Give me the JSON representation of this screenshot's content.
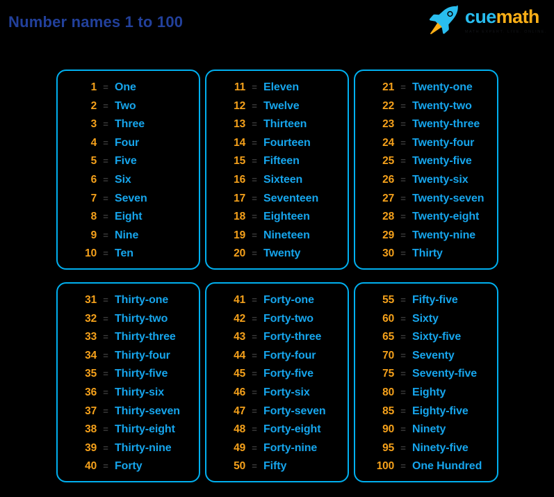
{
  "header": {
    "title": "Number names 1 to 100"
  },
  "logo": {
    "rocket_icon": "rocket-icon",
    "word_cue": "cue",
    "word_math": "math",
    "tagline": "MATH EXPERT. LIVE. ONLINE.",
    "colors": {
      "cue": "#28bdef",
      "math": "#fbaf17",
      "rocket_body": "#29bdef",
      "rocket_flame": "#fbaf17"
    }
  },
  "theme": {
    "background": "#000000",
    "card_border": "#00b0f0",
    "number_color": "#f5a11b",
    "equals_color": "#3b3b3b",
    "word_color": "#16a5ec",
    "title_color": "#22409b"
  },
  "cards": [
    {
      "id": "card-1-to-10",
      "rows": [
        {
          "number": "1",
          "equals": "=",
          "word": "One"
        },
        {
          "number": "2",
          "equals": "=",
          "word": "Two"
        },
        {
          "number": "3",
          "equals": "=",
          "word": "Three"
        },
        {
          "number": "4",
          "equals": "=",
          "word": "Four"
        },
        {
          "number": "5",
          "equals": "=",
          "word": "Five"
        },
        {
          "number": "6",
          "equals": "=",
          "word": "Six"
        },
        {
          "number": "7",
          "equals": "=",
          "word": "Seven"
        },
        {
          "number": "8",
          "equals": "=",
          "word": "Eight"
        },
        {
          "number": "9",
          "equals": "=",
          "word": "Nine"
        },
        {
          "number": "10",
          "equals": "=",
          "word": "Ten"
        }
      ]
    },
    {
      "id": "card-11-to-20",
      "rows": [
        {
          "number": "11",
          "equals": "=",
          "word": "Eleven"
        },
        {
          "number": "12",
          "equals": "=",
          "word": "Twelve"
        },
        {
          "number": "13",
          "equals": "=",
          "word": "Thirteen"
        },
        {
          "number": "14",
          "equals": "=",
          "word": "Fourteen"
        },
        {
          "number": "15",
          "equals": "=",
          "word": "Fifteen"
        },
        {
          "number": "16",
          "equals": "=",
          "word": "Sixteen"
        },
        {
          "number": "17",
          "equals": "=",
          "word": "Seventeen"
        },
        {
          "number": "18",
          "equals": "=",
          "word": "Eighteen"
        },
        {
          "number": "19",
          "equals": "=",
          "word": "Nineteen"
        },
        {
          "number": "20",
          "equals": "=",
          "word": "Twenty"
        }
      ]
    },
    {
      "id": "card-21-to-30",
      "rows": [
        {
          "number": "21",
          "equals": "=",
          "word": "Twenty-one"
        },
        {
          "number": "22",
          "equals": "=",
          "word": "Twenty-two"
        },
        {
          "number": "23",
          "equals": "=",
          "word": "Twenty-three"
        },
        {
          "number": "24",
          "equals": "=",
          "word": "Twenty-four"
        },
        {
          "number": "25",
          "equals": "=",
          "word": "Twenty-five"
        },
        {
          "number": "26",
          "equals": "=",
          "word": "Twenty-six"
        },
        {
          "number": "27",
          "equals": "=",
          "word": "Twenty-seven"
        },
        {
          "number": "28",
          "equals": "=",
          "word": "Twenty-eight"
        },
        {
          "number": "29",
          "equals": "=",
          "word": "Twenty-nine"
        },
        {
          "number": "30",
          "equals": "=",
          "word": "Thirty"
        }
      ]
    },
    {
      "id": "card-31-to-40",
      "rows": [
        {
          "number": "31",
          "equals": "=",
          "word": "Thirty-one"
        },
        {
          "number": "32",
          "equals": "=",
          "word": "Thirty-two"
        },
        {
          "number": "33",
          "equals": "=",
          "word": "Thirty-three"
        },
        {
          "number": "34",
          "equals": "=",
          "word": "Thirty-four"
        },
        {
          "number": "35",
          "equals": "=",
          "word": "Thirty-five"
        },
        {
          "number": "36",
          "equals": "=",
          "word": "Thirty-six"
        },
        {
          "number": "37",
          "equals": "=",
          "word": "Thirty-seven"
        },
        {
          "number": "38",
          "equals": "=",
          "word": "Thirty-eight"
        },
        {
          "number": "39",
          "equals": "=",
          "word": "Thirty-nine"
        },
        {
          "number": "40",
          "equals": "=",
          "word": "Forty"
        }
      ]
    },
    {
      "id": "card-41-to-50",
      "rows": [
        {
          "number": "41",
          "equals": "=",
          "word": "Forty-one"
        },
        {
          "number": "42",
          "equals": "=",
          "word": "Forty-two"
        },
        {
          "number": "43",
          "equals": "=",
          "word": "Forty-three"
        },
        {
          "number": "44",
          "equals": "=",
          "word": "Forty-four"
        },
        {
          "number": "45",
          "equals": "=",
          "word": "Forty-five"
        },
        {
          "number": "46",
          "equals": "=",
          "word": "Forty-six"
        },
        {
          "number": "47",
          "equals": "=",
          "word": "Forty-seven"
        },
        {
          "number": "48",
          "equals": "=",
          "word": "Forty-eight"
        },
        {
          "number": "49",
          "equals": "=",
          "word": "Forty-nine"
        },
        {
          "number": "50",
          "equals": "=",
          "word": "Fifty"
        }
      ]
    },
    {
      "id": "card-55-to-100",
      "rows": [
        {
          "number": "55",
          "equals": "=",
          "word": "Fifty-five"
        },
        {
          "number": "60",
          "equals": "=",
          "word": "Sixty"
        },
        {
          "number": "65",
          "equals": "=",
          "word": "Sixty-five"
        },
        {
          "number": "70",
          "equals": "=",
          "word": "Seventy"
        },
        {
          "number": "75",
          "equals": "=",
          "word": "Seventy-five"
        },
        {
          "number": "80",
          "equals": "=",
          "word": "Eighty"
        },
        {
          "number": "85",
          "equals": "=",
          "word": "Eighty-five"
        },
        {
          "number": "90",
          "equals": "=",
          "word": "Ninety"
        },
        {
          "number": "95",
          "equals": "=",
          "word": "Ninety-five"
        },
        {
          "number": "100",
          "equals": "=",
          "word": "One Hundred"
        }
      ]
    }
  ]
}
